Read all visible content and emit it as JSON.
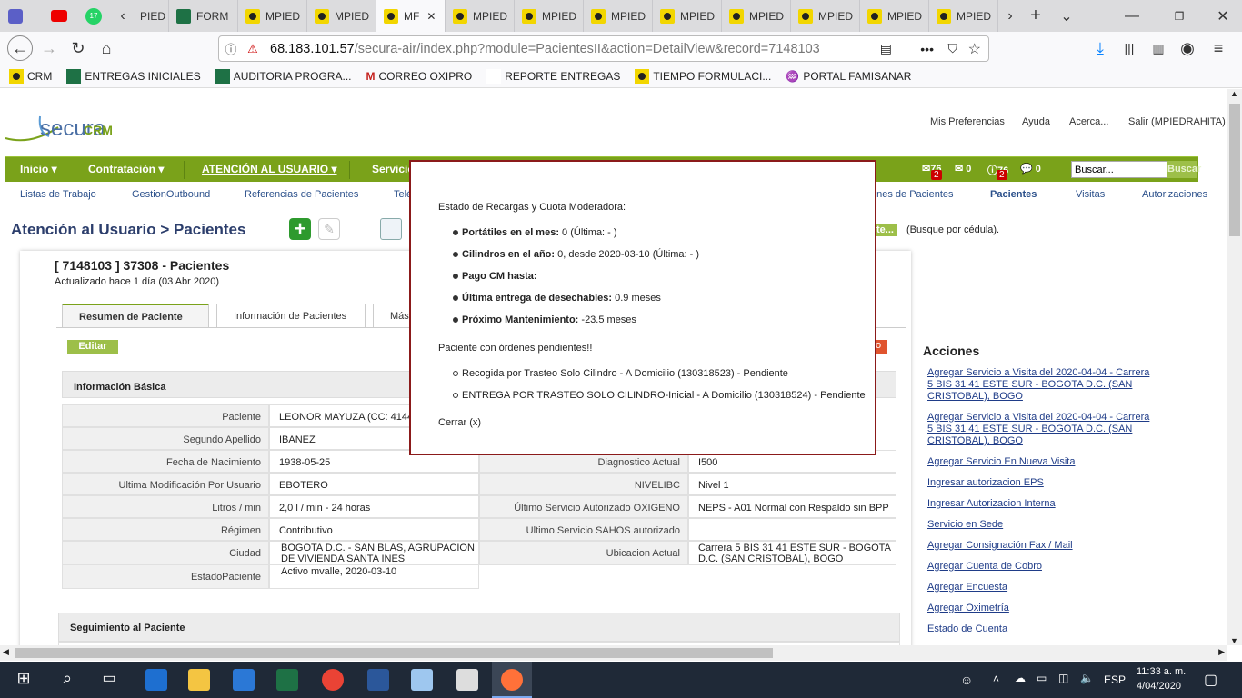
{
  "browser": {
    "tabs": [
      {
        "title": "PIED",
        "icon": "secura"
      },
      {
        "title": "FORM",
        "icon": "xl"
      },
      {
        "title": "MPIED",
        "icon": "secura"
      },
      {
        "title": "MPIED",
        "icon": "secura"
      },
      {
        "title": "MF",
        "icon": "secura",
        "active": true
      },
      {
        "title": "MPIED",
        "icon": "secura"
      },
      {
        "title": "MPIED",
        "icon": "secura"
      },
      {
        "title": "MPIED",
        "icon": "secura"
      },
      {
        "title": "MPIED",
        "icon": "secura"
      },
      {
        "title": "MPIED",
        "icon": "secura"
      },
      {
        "title": "MPIED",
        "icon": "secura"
      },
      {
        "title": "MPIED",
        "icon": "secura"
      },
      {
        "title": "MPIED",
        "icon": "secura"
      }
    ],
    "whatsapp_badge": "17",
    "url_host": "68.183.101.57",
    "url_path": "/secura-air/index.php?module=PacientesII&action=DetailView&record=7148103",
    "bookmarks": [
      "CRM",
      "ENTREGAS INICIALES",
      "AUDITORIA PROGRA...",
      "CORREO OXIPRO",
      "REPORTE ENTREGAS",
      "TIEMPO FORMULACI...",
      "PORTAL FAMISANAR"
    ]
  },
  "app": {
    "logo_text": "secura",
    "logo_suffix": "CRM",
    "top_links": [
      "Mis Preferencias",
      "Ayuda",
      "Acerca...",
      "Salir (MPIEDRAHITA)"
    ],
    "menu": [
      "Inicio",
      "Contratación",
      "ATENCIÓN AL USUARIO",
      "Servicio"
    ],
    "notif": [
      {
        "count": "76",
        "badge": "2"
      },
      {
        "count": "0"
      },
      {
        "count": "76",
        "badge": "2"
      },
      {
        "count": "0"
      }
    ],
    "search_value": "Buscar...",
    "search_button": "Buscar",
    "submenu": [
      "Listas de Trabajo",
      "GestionOutbound",
      "Referencias de Pacientes",
      "Telé",
      "ones de Pacientes",
      "Pacientes",
      "Visitas",
      "Autorizaciones"
    ],
    "page_title": "Atención al Usuario > Pacientes",
    "search_hint": "(Busque por cédula).",
    "search_btn_partial": "te...",
    "record_title": "[ 7148103 ] 37308 - Pacientes",
    "record_updated": "Actualizado hace 1 día (03 Abr 2020)",
    "tabs": [
      "Resumen de Paciente",
      "Información de Pacientes",
      "Más"
    ],
    "edit_button": "Editar",
    "red_button_partial": "o",
    "basic_info_title": "Información Básica",
    "left_rows": [
      {
        "label": "Paciente",
        "value": "LEONOR MAYUZA (CC: 4144"
      },
      {
        "label": "Segundo Apellido",
        "value": "IBANEZ"
      },
      {
        "label": "Fecha de Nacimiento",
        "value": "1938-05-25"
      },
      {
        "label": "Ultima Modificación Por Usuario",
        "value": "EBOTERO"
      },
      {
        "label": "Litros / min",
        "value": "2,0 l / min - 24 horas"
      },
      {
        "label": "Régimen",
        "value": "Contributivo"
      },
      {
        "label": "Ciudad",
        "value": "BOGOTA D.C. - SAN BLAS, AGRUPACION DE VIVIENDA SANTA INES"
      },
      {
        "label": "EstadoPaciente",
        "value": "Activo mvalle, 2020-03-10"
      }
    ],
    "right_rows": [
      {
        "label": "Diagnostico Actual",
        "value": "I500"
      },
      {
        "label": "NIVELIBC",
        "value": "Nivel 1"
      },
      {
        "label": "Último Servicio Autorizado OXIGENO",
        "value": "NEPS - A01 Normal con Respaldo sin BPP"
      },
      {
        "label": "Ultimo Servicio SAHOS autorizado",
        "value": ""
      },
      {
        "label": "Ubicacion Actual",
        "value": "Carrera 5 BIS 31 41 ESTE SUR - BOGOTA D.C. (SAN CRISTOBAL), BOGO"
      }
    ],
    "seguimiento_title": "Seguimiento al Paciente",
    "acciones_title": "Acciones",
    "acciones": [
      "Agregar Servicio a Visita del 2020-04-04 - Carrera 5 BIS 31 41 ESTE SUR - BOGOTA D.C. (SAN CRISTOBAL), BOGO",
      "Agregar Servicio a Visita del 2020-04-04 - Carrera 5 BIS 31 41 ESTE SUR - BOGOTA D.C. (SAN CRISTOBAL), BOGO",
      "Agregar Servicio En Nueva Visita",
      "Ingresar autorizacion EPS",
      "Ingresar Autorizacion Interna",
      "Servicio en Sede",
      "Agregar Consignación Fax / Mail",
      "Agregar Cuenta de Cobro",
      "Agregar Encuesta",
      "Agregar Oximetría",
      "Estado de Cuenta"
    ]
  },
  "popup": {
    "heading": "Estado de Recargas y Cuota Moderadora:",
    "items": [
      {
        "bold": "Portátiles en el mes:",
        "text": " 0 (Última: - )"
      },
      {
        "bold": "Cilindros en el año:",
        "text": " 0, desde 2020-03-10 (Última: - )"
      },
      {
        "bold": "Pago CM hasta:",
        "text": ""
      },
      {
        "bold": "Última entrega de desechables:",
        "text": " 0.9 meses"
      },
      {
        "bold": "Próximo Mantenimiento:",
        "text": " -23.5 meses"
      }
    ],
    "pending_heading": "Paciente con órdenes pendientes!!",
    "pending": [
      "Recogida por Trasteo Solo Cilindro - A Domicilio (130318523) - Pendiente",
      "ENTREGA POR TRASTEO SOLO CILINDRO-Inicial - A Domicilio (130318524) - Pendiente"
    ],
    "close": "Cerrar (x)"
  },
  "taskbar": {
    "lang": "ESP",
    "time": "11:33 a. m.",
    "date": "4/04/2020"
  },
  "colors": {
    "menu_green": "#7aa21a",
    "link_blue": "#1f3c88",
    "popup_border": "#8b1a1a"
  }
}
